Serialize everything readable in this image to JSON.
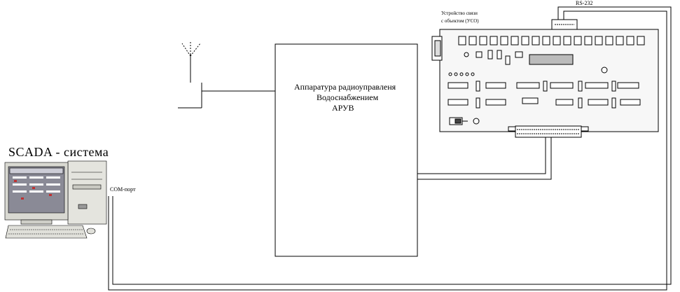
{
  "labels": {
    "scada_title": "SCADA - система",
    "com_port": "COM-порт",
    "rs232": "RS-232",
    "uso_line1": "Устройство связи",
    "uso_line2": "с объектом (УСО)",
    "aruv_line1": "Аппаратура радиоуправленя",
    "aruv_line2": "Водоснабжением",
    "aruv_line3": "АРУВ"
  },
  "colors": {
    "line": "#000000",
    "pcb_fill": "#f7f7f7",
    "monitor_body": "#d9d9d2",
    "screen_bg": "#8a8a96"
  },
  "icons": {
    "antenna": "antenna-icon",
    "computer": "computer-workstation-icon",
    "board": "circuit-board-icon"
  }
}
